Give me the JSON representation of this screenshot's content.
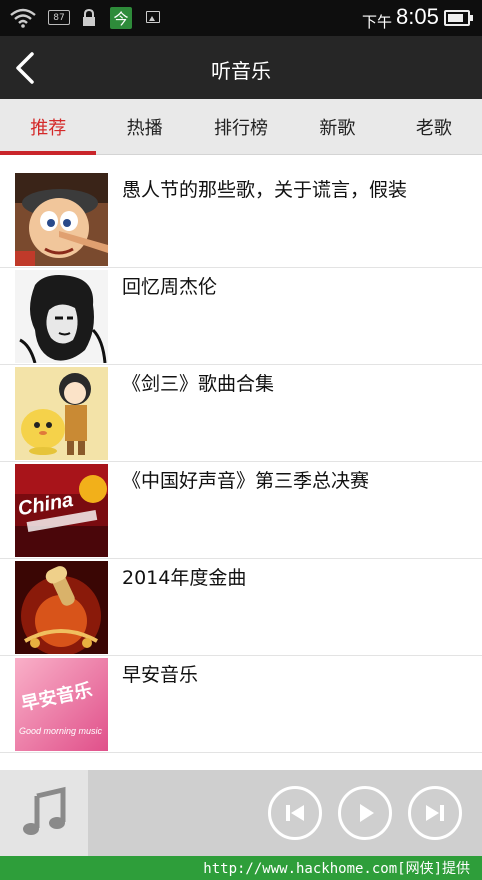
{
  "status_bar": {
    "badge_87": "87",
    "app_badge": "今",
    "time_prefix": "下午",
    "time": "8:05",
    "battery_level": 0.85
  },
  "title_bar": {
    "title": "听音乐",
    "back_icon": "chevron-left-icon"
  },
  "tabs": [
    {
      "label": "推荐",
      "active": true
    },
    {
      "label": "热播",
      "active": false
    },
    {
      "label": "排行榜",
      "active": false
    },
    {
      "label": "新歌",
      "active": false
    },
    {
      "label": "老歌",
      "active": false
    }
  ],
  "playlists": [
    {
      "title": "愚人节的那些歌，关于谎言，假装"
    },
    {
      "title": "回忆周杰伦"
    },
    {
      "title": "《剑三》歌曲合集"
    },
    {
      "title": "《中国好声音》第三季总决赛",
      "thumb_text": "China"
    },
    {
      "title": "2014年度金曲"
    },
    {
      "title": "早安音乐",
      "thumb_text_1": "早安音乐",
      "thumb_text_2": "Good morning music"
    }
  ],
  "player": {
    "art_icon": "music-note-icon",
    "prev_icon": "skip-previous-icon",
    "play_icon": "play-icon",
    "next_icon": "skip-next-icon"
  },
  "footer": {
    "text": "http://www.hackhome.com[网侠]提供"
  },
  "colors": {
    "accent": "#d42a2a",
    "titlebar": "#262626",
    "tabbar": "#e9e9e9",
    "footer": "#2e9e3a"
  }
}
